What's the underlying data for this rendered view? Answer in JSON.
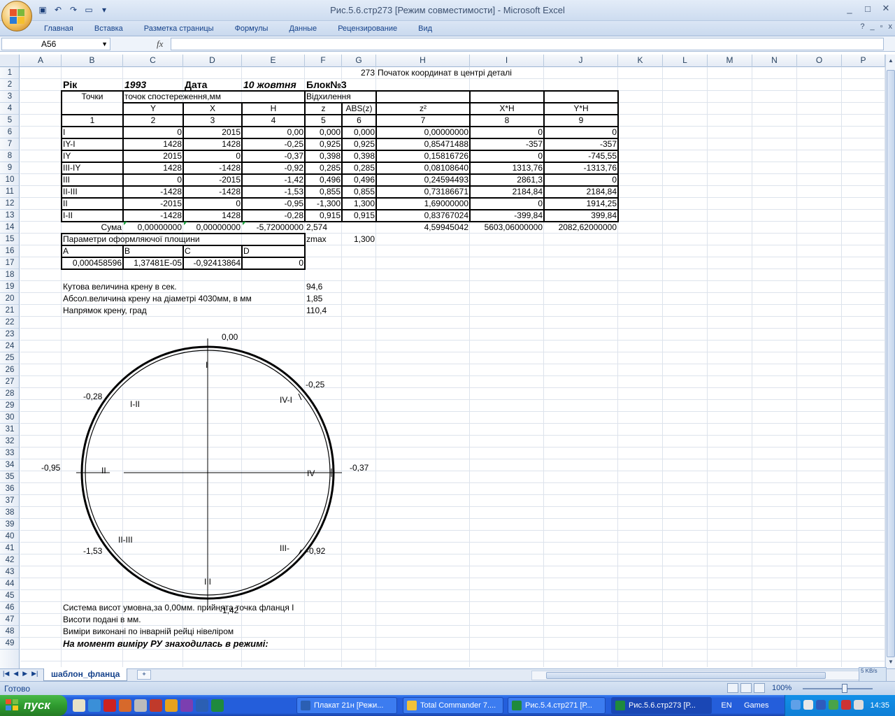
{
  "window": {
    "title": "Рис.5.6.стр273  [Режим совместимости] - Microsoft Excel",
    "controls": [
      "_",
      "□",
      "✕"
    ]
  },
  "ribbon": {
    "tabs": [
      "Главная",
      "Вставка",
      "Разметка страницы",
      "Формулы",
      "Данные",
      "Рецензирование",
      "Вид"
    ]
  },
  "formula_bar": {
    "name_box": "A56",
    "fx": "fx",
    "content": ""
  },
  "columns": [
    "A",
    "B",
    "C",
    "D",
    "E",
    "F",
    "G",
    "H",
    "I",
    "J",
    "K",
    "L",
    "M",
    "N",
    "O",
    "P"
  ],
  "rows": [
    "1",
    "2",
    "3",
    "4",
    "5",
    "6",
    "7",
    "8",
    "9",
    "10",
    "11",
    "12",
    "13",
    "14",
    "15",
    "16",
    "17",
    "18",
    "19",
    "20",
    "21",
    "22",
    "23",
    "24",
    "25",
    "26",
    "27",
    "28",
    "29",
    "30",
    "31",
    "32",
    "33",
    "34",
    "35",
    "36",
    "37",
    "38",
    "39",
    "40",
    "41",
    "42",
    "43",
    "44",
    "45",
    "46",
    "47",
    "48",
    "49"
  ],
  "sheet": {
    "r1": {
      "g": "273",
      "h": "Початок координат в центрі деталі"
    },
    "r2": {
      "b": "Рік",
      "c": "1993",
      "d": "Дата",
      "e": "10 жовтня",
      "f": "Блок№3"
    },
    "r3": {
      "b": "Точки",
      "c": "точок спостереження,мм",
      "f": "Відхилення"
    },
    "r4": {
      "c": "Y",
      "d": "X",
      "e": "H",
      "f": "z",
      "g": "ABS(z)",
      "h": "z²",
      "i": "X*H",
      "j": "Y*H"
    },
    "r5": [
      "1",
      "2",
      "3",
      "4",
      "5",
      "6",
      "7",
      "8",
      "9"
    ],
    "data": [
      [
        "I",
        "0",
        "2015",
        "0,00",
        "0,000",
        "0,000",
        "0,00000000",
        "0",
        "0"
      ],
      [
        "IY-I",
        "1428",
        "1428",
        "-0,25",
        "0,925",
        "0,925",
        "0,85471488",
        "-357",
        "-357"
      ],
      [
        "IY",
        "2015",
        "0",
        "-0,37",
        "0,398",
        "0,398",
        "0,15816726",
        "0",
        "-745,55"
      ],
      [
        "III-IY",
        "1428",
        "-1428",
        "-0,92",
        "0,285",
        "0,285",
        "0,08108640",
        "1313,76",
        "-1313,76"
      ],
      [
        "III",
        "0",
        "-2015",
        "-1,42",
        "0,496",
        "0,496",
        "0,24594493",
        "2861,3",
        "0"
      ],
      [
        "II-III",
        "-1428",
        "-1428",
        "-1,53",
        "0,855",
        "0,855",
        "0,73186671",
        "2184,84",
        "2184,84"
      ],
      [
        "II",
        "-2015",
        "0",
        "-0,95",
        "-1,300",
        "1,300",
        "1,69000000",
        "0",
        "1914,25"
      ],
      [
        "I-II",
        "-1428",
        "1428",
        "-0,28",
        "0,915",
        "0,915",
        "0,83767024",
        "-399,84",
        "399,84"
      ]
    ],
    "r14": {
      "b": "Сума",
      "c": "0,00000000",
      "d": "0,00000000",
      "e": "-5,72000000",
      "f": "2,574",
      "h": "4,59945042",
      "i": "5603,06000000",
      "j": "2082,62000000"
    },
    "r15": {
      "b": "Параметри оформляючої площини",
      "f": "zmax",
      "g": "1,300"
    },
    "r16": {
      "b": "A",
      "c": "B",
      "d": "C",
      "e": "D"
    },
    "r17": {
      "b": "0,000458596",
      "c": "1,37481E-05",
      "d": "-0,92413864",
      "e": "0"
    },
    "r19": {
      "b": "Кутова величина крену в сек.",
      "f": "94,6"
    },
    "r20": {
      "b": "Абсол.величина крену на діаметрі 4030мм, в мм",
      "f": "1,85"
    },
    "r21": {
      "b": "Напрямок крену, град",
      "f": "110,4"
    },
    "r46": "Система висот умовна,за 0,00мм. прийнята точка фланця I",
    "r47": "Висоти подані в мм.",
    "r48": "Виміри   виконані  по  інварній  рейці  нівеліром",
    "r49": "На момент виміру РУ знаходилась в режимі:"
  },
  "diagram": {
    "points": [
      {
        "label": "I",
        "value": "0,00"
      },
      {
        "label": "IV-I",
        "value": "-0,25"
      },
      {
        "label": "IV",
        "value": "-0,37"
      },
      {
        "label": "III-",
        "value": "-0,92"
      },
      {
        "label": "III",
        "value": "-1,42"
      },
      {
        "label": "II-III",
        "value": "-1,53"
      },
      {
        "label": "II",
        "value": "-0,95"
      },
      {
        "label": "I-II",
        "value": "-0,28"
      }
    ]
  },
  "sheet_tab": "шаблон_фланца",
  "status": {
    "text": "Готово",
    "zoom": "100%",
    "net": "5 KB/s"
  },
  "taskbar": {
    "start": "пуск",
    "tasks": [
      "Плакат 21н [Режи...",
      "Total Commander 7....",
      "Рис.5.4.стр271  [Р...",
      "Рис.5.6.стр273  [Р..."
    ],
    "lang": "EN",
    "games": "Games",
    "clock": "14:35"
  },
  "colors": {
    "accent": "#15428b",
    "taskbar": "#245edb",
    "start": "#2f9b2f"
  }
}
